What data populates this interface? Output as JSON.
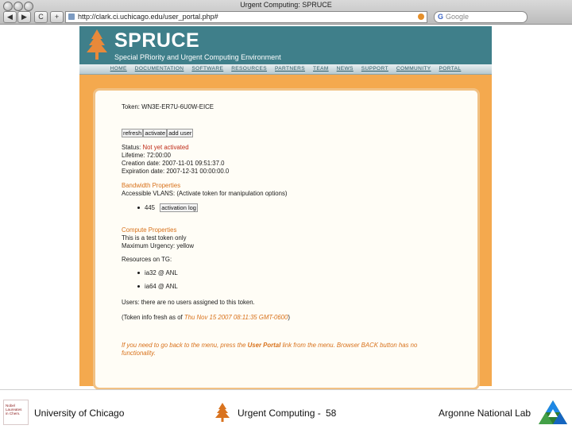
{
  "browser": {
    "window_title": "Urgent Computing: SPRUCE",
    "url": "http://clark.ci.uchicago.edu/user_portal.php#",
    "search_placeholder": "Google",
    "back_glyph": "◀",
    "forward_glyph": "▶",
    "reload_glyph": "C",
    "add_glyph": "+"
  },
  "site": {
    "title": "SPRUCE",
    "subtitle": "Special PRiority and Urgent Computing Environment",
    "nav": [
      "HOME",
      "DOCUMENTATION",
      "SOFTWARE",
      "RESOURCES",
      "PARTNERS",
      "TEAM",
      "NEWS",
      "SUPPORT",
      "COMMUNITY",
      "PORTAL"
    ]
  },
  "token": {
    "token_label": "Token: WN3E-ER7U-6U0W-EICE",
    "buttons": [
      "refresh",
      "activate",
      "add user"
    ],
    "status_label": "Status:",
    "status_value": "Not yet activated",
    "lifetime": "Lifetime: 72:00:00",
    "creation": "Creation date: 2007-11-01 09:51:37.0",
    "expiration": "Expiration date: 2007-12-31 00:00:00.0",
    "bandwidth_heading": "Bandwidth Properties",
    "vlans_text": "Accessible VLANS: (Activate token for manipulation options)",
    "vlan_value": "445",
    "activation_log_button": "activation log",
    "compute_heading": "Compute Properties",
    "compute_desc": "This is a test token only",
    "max_urgency": "Maximum Urgency: yellow",
    "resources_label": "Resources on TG:",
    "resources": [
      "ia32 @ ANL",
      "ia64 @ ANL"
    ],
    "users_text": "Users: there are no users assigned to this token.",
    "fresh_prefix": "(Token info fresh as of",
    "fresh_date": "Thu Nov 15 2007 08:11:35 GMT-0600",
    "fresh_suffix": ")",
    "notice_line1_prefix": "If you need to go back to the menu, press the",
    "notice_link": "User Portal",
    "notice_line1_suffix": "link from the menu. Browser BACK button has no",
    "notice_line2": "functionality."
  },
  "slide_footer": {
    "left": "University of Chicago",
    "center": "Urgent Computing -",
    "page_number": "58",
    "right": "Argonne National Lab"
  },
  "colors": {
    "banner": "#3f7f8a",
    "page_background": "#f4a94e",
    "accent_orange": "#d8711a",
    "status_red": "#bf2a16"
  }
}
